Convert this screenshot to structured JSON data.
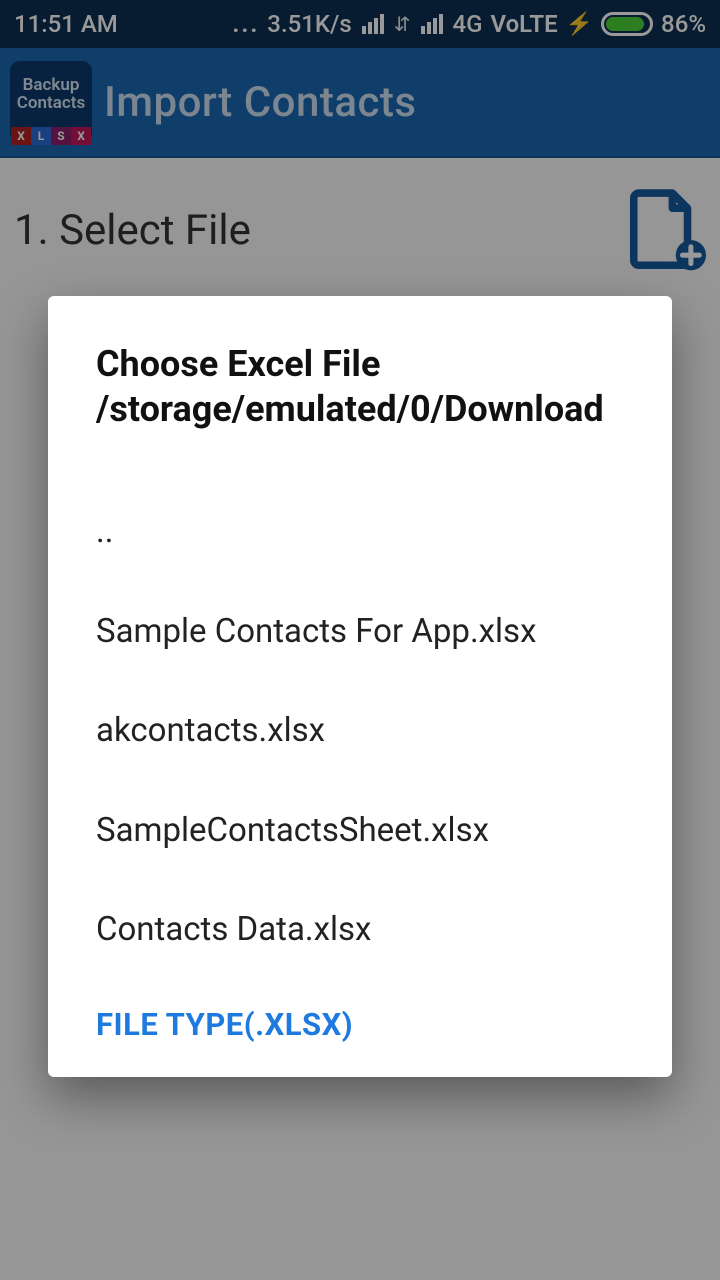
{
  "status": {
    "time": "11:51 AM",
    "net_speed": "3.51K/s",
    "net_label": "4G",
    "volte": "VoLTE",
    "battery_pct": "86%"
  },
  "appbar": {
    "icon_line1": "Backup",
    "icon_line2": "Contacts",
    "title": "Import Contacts"
  },
  "main": {
    "step_label": "1. Select File"
  },
  "dialog": {
    "title_line1": "Choose Excel File",
    "title_line2": "/storage/emulated/0/Download",
    "items": [
      "..",
      "Sample Contacts For App.xlsx",
      "akcontacts.xlsx",
      "SampleContactsSheet.xlsx",
      "Contacts Data.xlsx"
    ],
    "file_type_label": "FILE TYPE(.XLSX)"
  }
}
